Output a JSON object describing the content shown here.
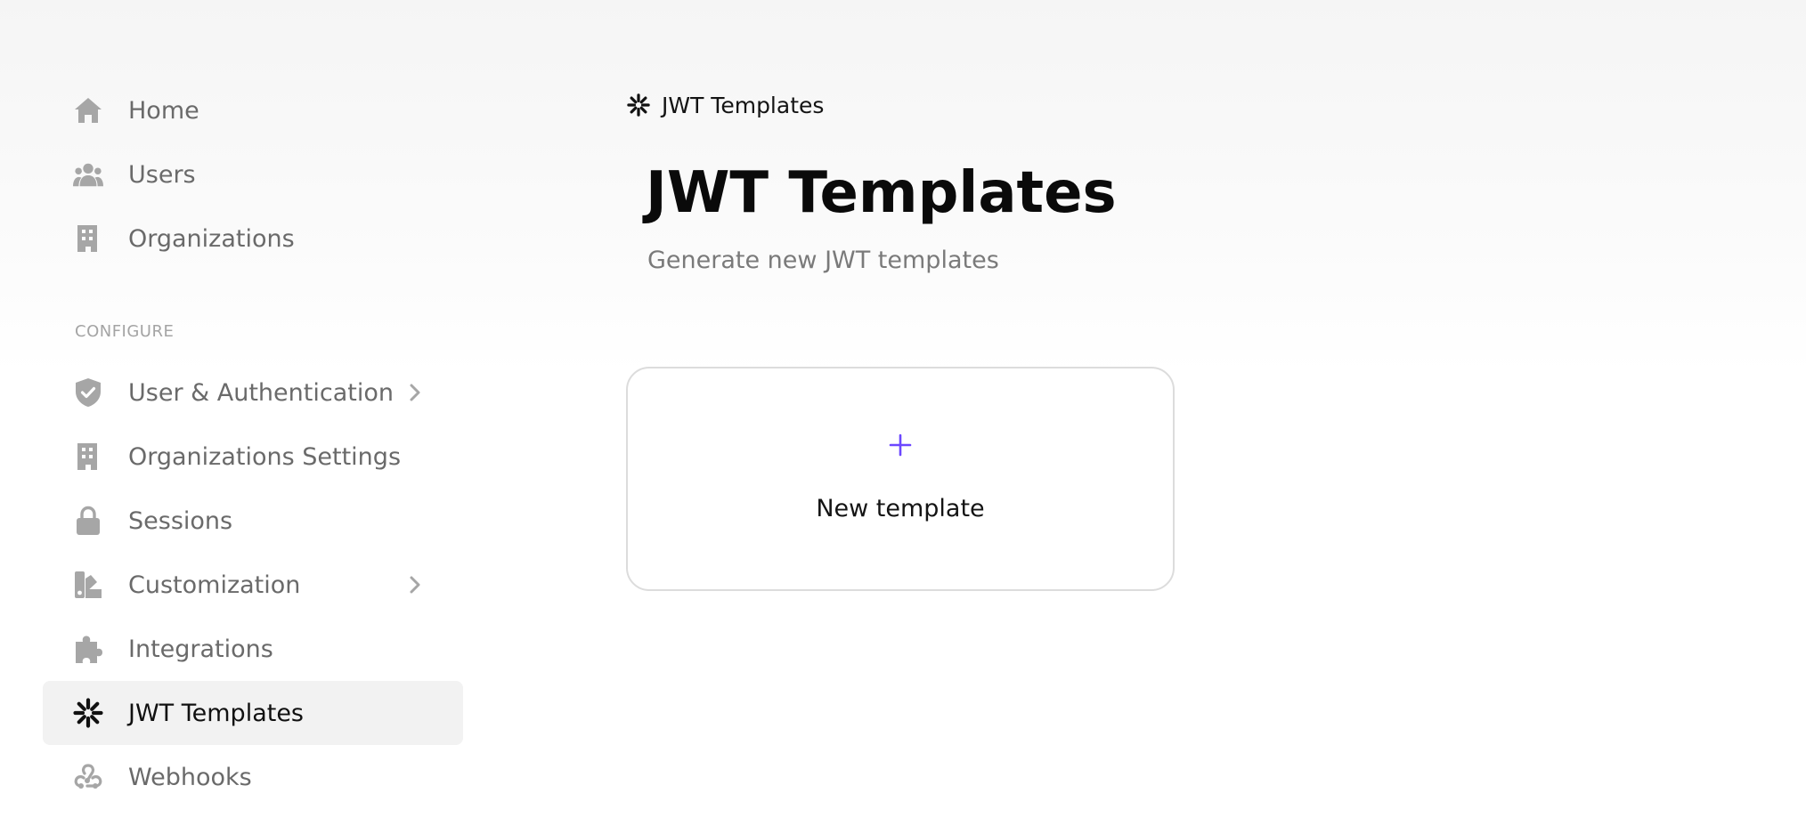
{
  "sidebar": {
    "main_items": [
      {
        "label": "Home",
        "icon": "home-icon"
      },
      {
        "label": "Users",
        "icon": "users-icon"
      },
      {
        "label": "Organizations",
        "icon": "building-icon"
      }
    ],
    "section_heading": "CONFIGURE",
    "configure_items": [
      {
        "label": "User & Authentication",
        "icon": "shield-check-icon",
        "has_chevron": true
      },
      {
        "label": "Organizations Settings",
        "icon": "building-icon",
        "has_chevron": false
      },
      {
        "label": "Sessions",
        "icon": "lock-icon",
        "has_chevron": false
      },
      {
        "label": "Customization",
        "icon": "palette-icon",
        "has_chevron": true
      },
      {
        "label": "Integrations",
        "icon": "puzzle-icon",
        "has_chevron": false
      },
      {
        "label": "JWT Templates",
        "icon": "asterisk-burst-icon",
        "has_chevron": false,
        "active": true
      },
      {
        "label": "Webhooks",
        "icon": "webhooks-icon",
        "has_chevron": false
      }
    ]
  },
  "breadcrumb": {
    "label": "JWT Templates",
    "icon": "asterisk-burst-icon"
  },
  "header": {
    "title": "JWT Templates",
    "subtitle": "Generate new JWT templates"
  },
  "new_template_card": {
    "label": "New template",
    "icon": "plus-icon"
  },
  "colors": {
    "accent": "#6c47ff",
    "icon_gray": "#a6a6a6",
    "active_bg": "#f2f2f2",
    "text_muted": "#6a6a6a",
    "text_dark": "#111111"
  }
}
